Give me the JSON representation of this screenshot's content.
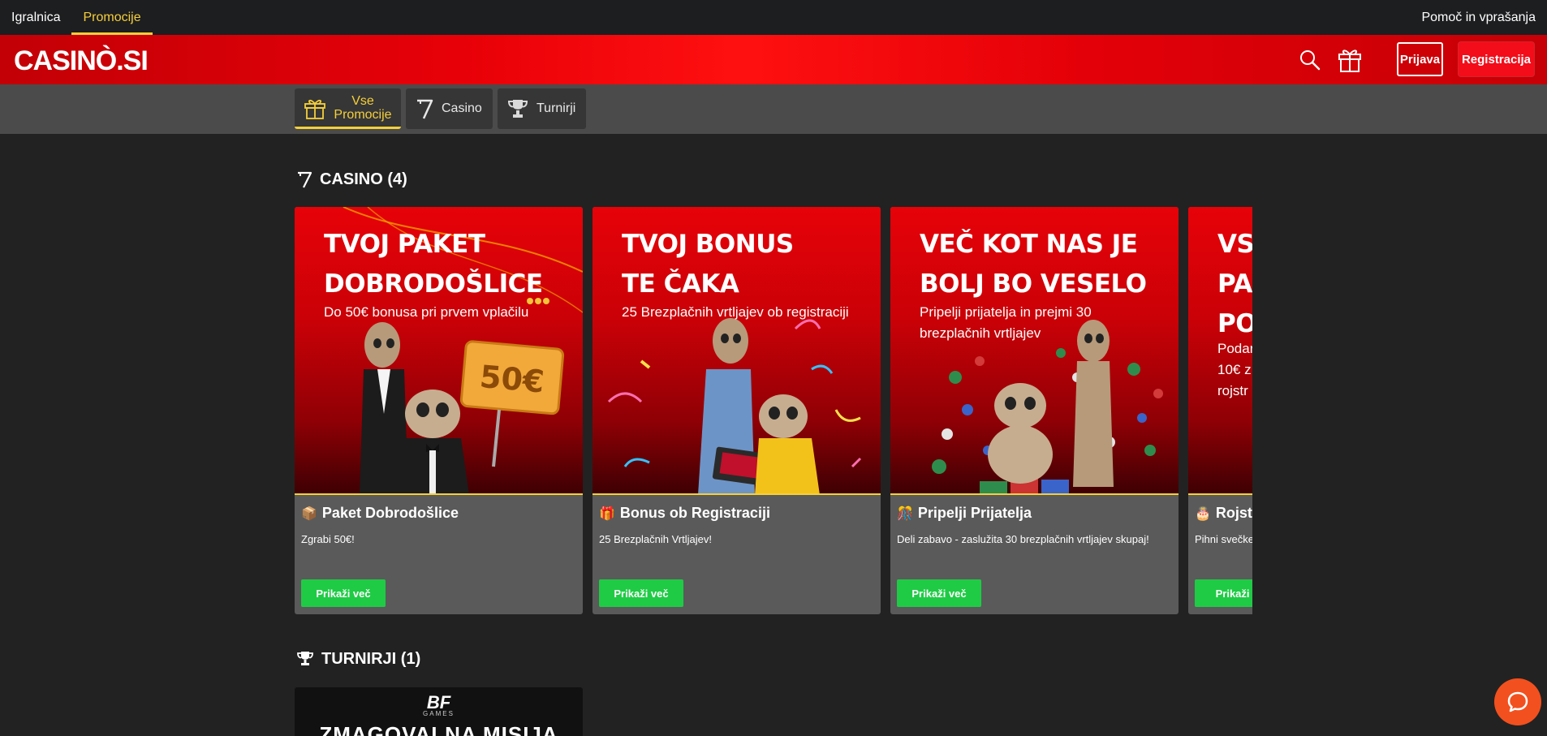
{
  "topbar": {
    "tabs": [
      {
        "label": "Igralnica"
      },
      {
        "label": "Promocije"
      }
    ],
    "help": "Pomoč in vprašanja"
  },
  "header": {
    "logo": "CASINÒ.SI",
    "login": "Prijava",
    "register": "Registracija"
  },
  "filters": [
    {
      "label": "Vse Promocije",
      "icon": "gift-icon"
    },
    {
      "label": "Casino",
      "icon": "seven-icon"
    },
    {
      "label": "Turnirji",
      "icon": "trophy-icon"
    }
  ],
  "sections": {
    "casino": {
      "title": "CASINO (4)"
    },
    "turnirji": {
      "title": "TURNIRJI (1)"
    }
  },
  "cards": [
    {
      "banner_title_1": "TVOJ PAKET",
      "banner_title_2": "DOBRODOŠLICE",
      "banner_text": "Do 50€ bonusa pri prvem vplačilu",
      "sign": "50€",
      "emoji": "📦",
      "title": "Paket Dobrodošlice",
      "desc": "Zgrabi 50€!",
      "button": "Prikaži več"
    },
    {
      "banner_title_1": "TVOJ BONUS",
      "banner_title_2": "TE ČAKA",
      "banner_text": "25 Brezplačnih vrtljajev ob registraciji",
      "emoji": "🎁",
      "title": "Bonus ob Registraciji",
      "desc": "25 Brezplačnih Vrtljajev!",
      "button": "Prikaži več"
    },
    {
      "banner_title_1": "VEČ KOT NAS JE",
      "banner_title_2": "BOLJ BO VESELO",
      "banner_text": "Pripelji prijatelja in prejmi 30 brezplačnih vrtljajev",
      "emoji": "🎊",
      "title": "Pripelji Prijatelja",
      "desc": "Deli zabavo - zaslužita 30 brezplačnih vrtljajev skupaj!",
      "button": "Prikaži več"
    },
    {
      "banner_title_1": "VS",
      "banner_title_2": "PA",
      "banner_title_3": "PO",
      "banner_text_1": "Podar",
      "banner_text_2": "10€ z",
      "banner_text_3": "rojstr",
      "emoji": "🎂",
      "title": "Rojst",
      "desc": "Pihni svečke",
      "button": "Prikaži v"
    }
  ],
  "turnir": {
    "brand": "BF",
    "brand_sub": "GAMES",
    "title": "ZMAGOVALNA MISIJA"
  },
  "colors": {
    "accent": "#f5cf3a",
    "brand_red": "#e80008",
    "cta_green": "#1fcb45",
    "chat": "#f2501e"
  }
}
